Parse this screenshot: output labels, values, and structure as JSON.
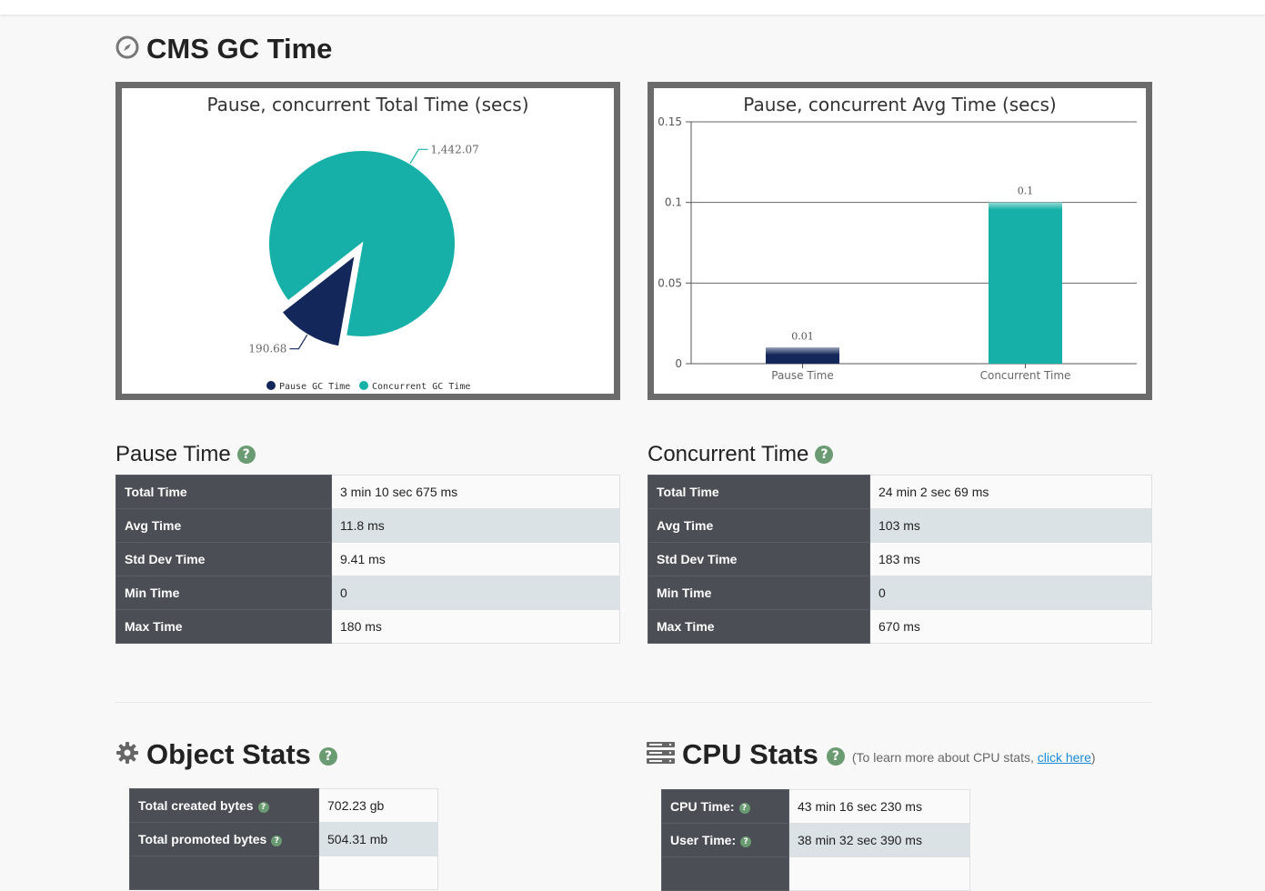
{
  "cms": {
    "title": "CMS GC Time",
    "title_icon": "compass-icon",
    "total_chart": {
      "title": "Pause, concurrent Total Time (secs)",
      "legend": [
        "Pause GC Time",
        "Concurrent GC Time"
      ],
      "labels": [
        "190.68",
        "1,442.07"
      ]
    },
    "avg_chart": {
      "title": "Pause, concurrent Avg Time (secs)",
      "y_ticks": [
        "0.15",
        "0.1",
        "0.05",
        "0"
      ],
      "categories": [
        "Pause Time",
        "Concurrent Time"
      ],
      "value_labels": [
        "0.01",
        "0.1"
      ]
    }
  },
  "chart_data": [
    {
      "type": "pie",
      "title": "Pause, concurrent Total Time (secs)",
      "labels": [
        "Pause GC Time",
        "Concurrent GC Time"
      ],
      "values": [
        190.68,
        1442.07
      ],
      "colors": [
        "#13275a",
        "#17b0a8"
      ],
      "legend": "bottom-center"
    },
    {
      "type": "bar",
      "title": "Pause, concurrent Avg Time (secs)",
      "categories": [
        "Pause Time",
        "Concurrent Time"
      ],
      "values": [
        0.01,
        0.1
      ],
      "colors": [
        "#13275a",
        "#17b0a8"
      ],
      "ylim": [
        0,
        0.15
      ],
      "yticks": [
        0,
        0.05,
        0.1,
        0.15
      ],
      "grid": true
    }
  ],
  "pause": {
    "title": "Pause Time",
    "rows": [
      {
        "label": "Total Time",
        "value": "3 min 10 sec 675 ms"
      },
      {
        "label": "Avg Time",
        "value": "11.8 ms"
      },
      {
        "label": "Std Dev Time",
        "value": "9.41 ms"
      },
      {
        "label": "Min Time",
        "value": "0"
      },
      {
        "label": "Max Time",
        "value": "180 ms"
      }
    ]
  },
  "concurrent": {
    "title": "Concurrent Time",
    "rows": [
      {
        "label": "Total Time",
        "value": "24 min 2 sec 69 ms"
      },
      {
        "label": "Avg Time",
        "value": "103 ms"
      },
      {
        "label": "Std Dev Time",
        "value": "183 ms"
      },
      {
        "label": "Min Time",
        "value": "0"
      },
      {
        "label": "Max Time",
        "value": "670 ms"
      }
    ]
  },
  "object_stats": {
    "title": "Object Stats",
    "title_icon": "gear-icon",
    "rows": [
      {
        "label": "Total created bytes",
        "value": "702.23 gb"
      },
      {
        "label": "Total promoted bytes",
        "value": "504.31 mb"
      }
    ]
  },
  "cpu_stats": {
    "title": "CPU Stats",
    "title_icon": "server-icon",
    "note_prefix": "(To learn more about CPU stats, ",
    "note_link": "click here",
    "note_suffix": ")",
    "rows": [
      {
        "label": "CPU Time:",
        "value": "43 min 16 sec 230 ms"
      },
      {
        "label": "User Time:",
        "value": "38 min 32 sec 390 ms"
      }
    ]
  },
  "help_glyph": "?"
}
